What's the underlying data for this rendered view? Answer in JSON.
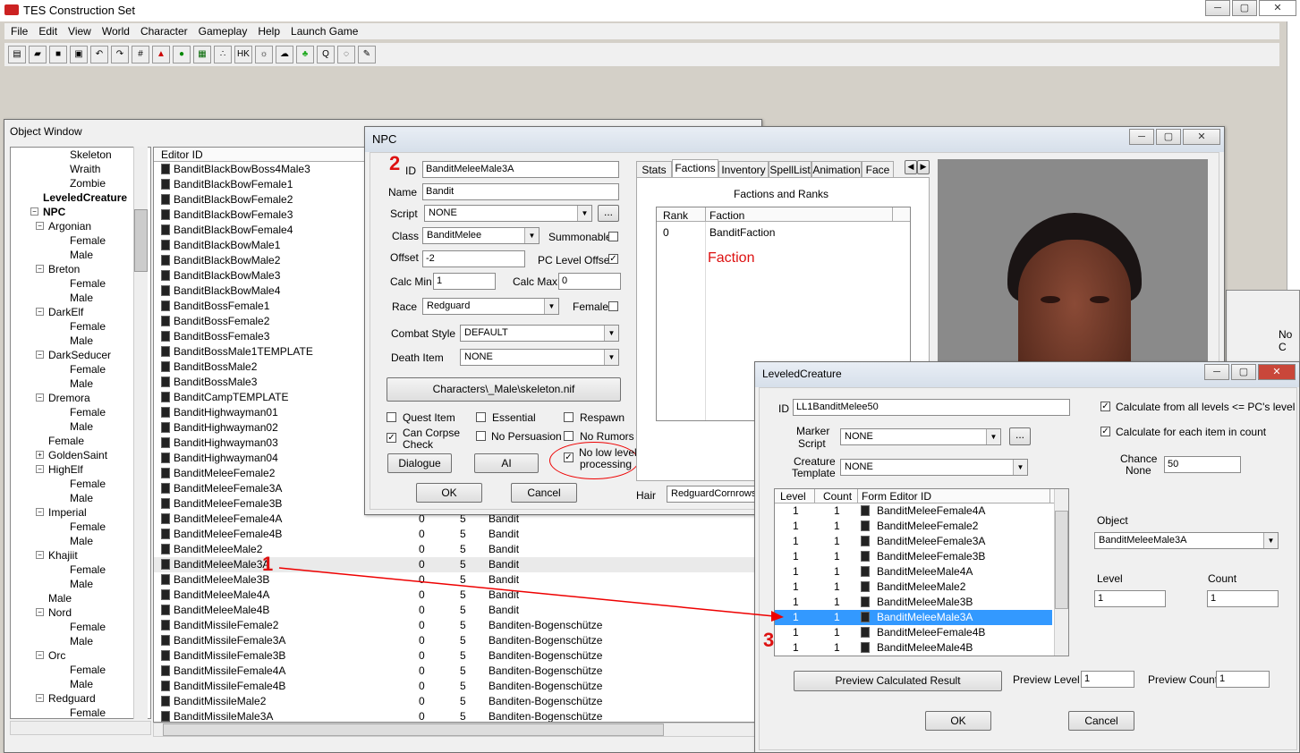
{
  "app": {
    "title": "TES Construction Set",
    "menu": [
      "File",
      "Edit",
      "View",
      "World",
      "Character",
      "Gameplay",
      "Help",
      "Launch Game"
    ]
  },
  "object_window": {
    "title": "Object Window",
    "tree": [
      {
        "t": "Skeleton",
        "l": 3
      },
      {
        "t": "Wraith",
        "l": 3
      },
      {
        "t": "Zombie",
        "l": 3
      },
      {
        "t": "LeveledCreature",
        "l": 1,
        "b": true
      },
      {
        "t": "NPC",
        "l": 1,
        "b": true,
        "x": "−"
      },
      {
        "t": "Argonian",
        "l": 2,
        "x": "−"
      },
      {
        "t": "Female",
        "l": 3
      },
      {
        "t": "Male",
        "l": 3
      },
      {
        "t": "Breton",
        "l": 2,
        "x": "−"
      },
      {
        "t": "Female",
        "l": 3
      },
      {
        "t": "Male",
        "l": 3
      },
      {
        "t": "DarkElf",
        "l": 2,
        "x": "−"
      },
      {
        "t": "Female",
        "l": 3
      },
      {
        "t": "Male",
        "l": 3
      },
      {
        "t": "DarkSeducer",
        "l": 2,
        "x": "−"
      },
      {
        "t": "Female",
        "l": 3
      },
      {
        "t": "Male",
        "l": 3
      },
      {
        "t": "Dremora",
        "l": 2,
        "x": "−"
      },
      {
        "t": "Female",
        "l": 3
      },
      {
        "t": "Male",
        "l": 3
      },
      {
        "t": "Female",
        "l": 2
      },
      {
        "t": "GoldenSaint",
        "l": 2,
        "x": "+"
      },
      {
        "t": "HighElf",
        "l": 2,
        "x": "−"
      },
      {
        "t": "Female",
        "l": 3
      },
      {
        "t": "Male",
        "l": 3
      },
      {
        "t": "Imperial",
        "l": 2,
        "x": "−"
      },
      {
        "t": "Female",
        "l": 3
      },
      {
        "t": "Male",
        "l": 3
      },
      {
        "t": "Khajiit",
        "l": 2,
        "x": "−"
      },
      {
        "t": "Female",
        "l": 3
      },
      {
        "t": "Male",
        "l": 3
      },
      {
        "t": "Male",
        "l": 2
      },
      {
        "t": "Nord",
        "l": 2,
        "x": "−"
      },
      {
        "t": "Female",
        "l": 3
      },
      {
        "t": "Male",
        "l": 3
      },
      {
        "t": "Orc",
        "l": 2,
        "x": "−"
      },
      {
        "t": "Female",
        "l": 3
      },
      {
        "t": "Male",
        "l": 3
      },
      {
        "t": "Redguard",
        "l": 2,
        "x": "−"
      },
      {
        "t": "Female",
        "l": 3
      }
    ],
    "col_editor": "Editor ID",
    "rows": [
      [
        "BanditBlackBowBoss4Male3",
        "",
        "",
        ""
      ],
      [
        "BanditBlackBowFemale1",
        "",
        "",
        ""
      ],
      [
        "BanditBlackBowFemale2",
        "",
        "",
        ""
      ],
      [
        "BanditBlackBowFemale3",
        "",
        "",
        ""
      ],
      [
        "BanditBlackBowFemale4",
        "",
        "",
        ""
      ],
      [
        "BanditBlackBowMale1",
        "",
        "",
        ""
      ],
      [
        "BanditBlackBowMale2",
        "",
        "",
        ""
      ],
      [
        "BanditBlackBowMale3",
        "",
        "",
        ""
      ],
      [
        "BanditBlackBowMale4",
        "",
        "",
        ""
      ],
      [
        "BanditBossFemale1",
        "",
        "",
        ""
      ],
      [
        "BanditBossFemale2",
        "",
        "",
        ""
      ],
      [
        "BanditBossFemale3",
        "",
        "",
        ""
      ],
      [
        "BanditBossMale1TEMPLATE",
        "",
        "",
        ""
      ],
      [
        "BanditBossMale2",
        "",
        "",
        ""
      ],
      [
        "BanditBossMale3",
        "",
        "",
        ""
      ],
      [
        "BanditCampTEMPLATE",
        "",
        "",
        ""
      ],
      [
        "BanditHighwayman01",
        "",
        "",
        ""
      ],
      [
        "BanditHighwayman02",
        "",
        "",
        ""
      ],
      [
        "BanditHighwayman03",
        "",
        "",
        ""
      ],
      [
        "BanditHighwayman04",
        "",
        "",
        ""
      ],
      [
        "BanditMeleeFemale2",
        "",
        "",
        ""
      ],
      [
        "BanditMeleeFemale3A",
        "",
        "",
        ""
      ],
      [
        "BanditMeleeFemale3B",
        "",
        "",
        ""
      ],
      [
        "BanditMeleeFemale4A",
        "0",
        "5",
        "Bandit"
      ],
      [
        "BanditMeleeFemale4B",
        "0",
        "5",
        "Bandit"
      ],
      [
        "BanditMeleeMale2",
        "0",
        "5",
        "Bandit"
      ],
      [
        "BanditMeleeMale3A",
        "0",
        "5",
        "Bandit"
      ],
      [
        "BanditMeleeMale3B",
        "0",
        "5",
        "Bandit"
      ],
      [
        "BanditMeleeMale4A",
        "0",
        "5",
        "Bandit"
      ],
      [
        "BanditMeleeMale4B",
        "0",
        "5",
        "Bandit"
      ],
      [
        "BanditMissileFemale2",
        "0",
        "5",
        "Banditen-Bogenschütze"
      ],
      [
        "BanditMissileFemale3A",
        "0",
        "5",
        "Banditen-Bogenschütze"
      ],
      [
        "BanditMissileFemale3B",
        "0",
        "5",
        "Banditen-Bogenschütze"
      ],
      [
        "BanditMissileFemale4A",
        "0",
        "5",
        "Banditen-Bogenschütze"
      ],
      [
        "BanditMissileFemale4B",
        "0",
        "5",
        "Banditen-Bogenschütze"
      ],
      [
        "BanditMissileMale2",
        "0",
        "5",
        "Banditen-Bogenschütze"
      ],
      [
        "BanditMissileMale3A",
        "0",
        "5",
        "Banditen-Bogenschütze"
      ]
    ]
  },
  "npc": {
    "title": "NPC",
    "num": "2",
    "id_label": "ID",
    "id": "BanditMeleeMale3A",
    "name_label": "Name",
    "name": "Bandit",
    "script_label": "Script",
    "script": "NONE",
    "class_label": "Class",
    "class": "BanditMelee",
    "summonable": "Summonable",
    "offset_label": "Offset",
    "offset": "-2",
    "pc_level_offset": "PC Level Offset",
    "calc_min_label": "Calc Min",
    "calc_min": "1",
    "calc_max_label": "Calc Max",
    "calc_max": "0",
    "race_label": "Race",
    "race": "Redguard",
    "female": "Female",
    "combat_label": "Combat Style",
    "combat": "DEFAULT",
    "death_label": "Death Item",
    "death": "NONE",
    "skeleton": "Characters\\_Male\\skeleton.nif",
    "quest_item": "Quest Item",
    "essential": "Essential",
    "respawn": "Respawn",
    "can_corpse": "Can Corpse",
    "check": "Check",
    "no_persuasion": "No Persuasion",
    "no_rumors": "No Rumors",
    "no_low_1": "No low level",
    "no_low_2": "processing",
    "dialogue": "Dialogue",
    "ai": "AI",
    "ok": "OK",
    "cancel": "Cancel",
    "hair_label": "Hair",
    "hair": "RedguardCornrows",
    "tabs": [
      "Stats",
      "Factions",
      "Inventory",
      "SpellList",
      "Animation",
      "Face"
    ],
    "factions_title": "Factions and Ranks",
    "col_rank": "Rank",
    "col_faction": "Faction",
    "rank": "0",
    "faction": "BanditFaction",
    "faction_note": "Faction"
  },
  "bg_right": "No C",
  "leveled": {
    "title": "LeveledCreature",
    "id_label": "ID",
    "id": "LL1BanditMelee50",
    "marker_1": "Marker",
    "marker_2": "Script",
    "marker": "NONE",
    "creature_1": "Creature",
    "creature_2": "Template",
    "creature": "NONE",
    "calc_all": "Calculate from all levels <= PC's level",
    "calc_each": "Calculate for each item in count",
    "chance_1": "Chance",
    "chance_2": "None",
    "chance": "50",
    "col_level": "Level",
    "col_count": "Count",
    "col_form": "Form Editor ID",
    "rows": [
      [
        "1",
        "1",
        "BanditMeleeFemale4A"
      ],
      [
        "1",
        "1",
        "BanditMeleeFemale2"
      ],
      [
        "1",
        "1",
        "BanditMeleeFemale3A"
      ],
      [
        "1",
        "1",
        "BanditMeleeFemale3B"
      ],
      [
        "1",
        "1",
        "BanditMeleeMale4A"
      ],
      [
        "1",
        "1",
        "BanditMeleeMale2"
      ],
      [
        "1",
        "1",
        "BanditMeleeMale3B"
      ],
      [
        "1",
        "1",
        "BanditMeleeMale3A"
      ],
      [
        "1",
        "1",
        "BanditMeleeFemale4B"
      ],
      [
        "1",
        "1",
        "BanditMeleeMale4B"
      ]
    ],
    "object_label": "Object",
    "object": "BanditMeleeMale3A",
    "level_label": "Level",
    "level": "1",
    "count_label": "Count",
    "count": "1",
    "preview_btn": "Preview Calculated Result",
    "preview_level_label": "Preview Level",
    "preview_level": "1",
    "preview_count_label": "Preview Count",
    "preview_count": "1",
    "ok": "OK",
    "cancel": "Cancel"
  },
  "annotations": {
    "n1": "1",
    "n3": "3"
  }
}
